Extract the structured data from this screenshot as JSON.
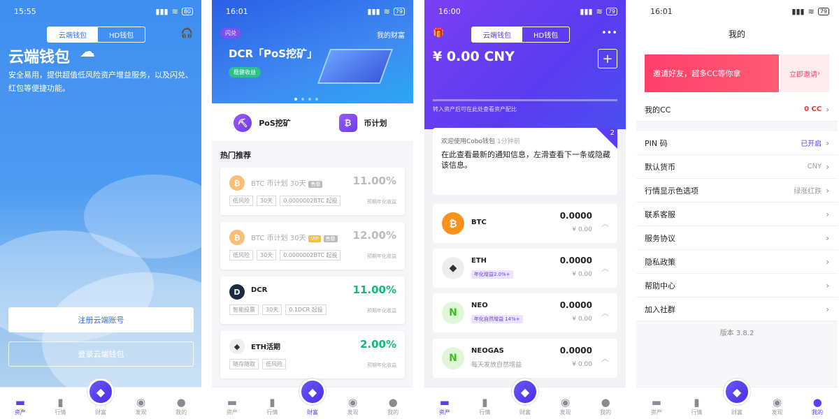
{
  "screen1": {
    "status": {
      "time": "15:55",
      "battery": "80"
    },
    "tabs": [
      "云端钱包",
      "HD钱包"
    ],
    "title": "云端钱包",
    "desc": "安全易用，提供超值低风险资产增益服务，以及闪兑、红包等便捷功能。",
    "register": "注册云端账号",
    "login": "登录云端钱包",
    "nav": [
      "资产",
      "行情",
      "财富",
      "发现",
      "我的"
    ]
  },
  "screen2": {
    "status": {
      "time": "16:01",
      "battery": "79"
    },
    "flash": "闪兑",
    "my_wealth": "我的财富",
    "banner_title": "DCR「PoS挖矿」",
    "banner_tag": "稳健收益",
    "shortcuts": [
      "PoS挖矿",
      "币计划"
    ],
    "hot_title": "热门推荐",
    "cards": [
      {
        "name": "BTC 币计划 30天",
        "badge": "售罄",
        "badge2": "",
        "rate": "11.00%",
        "tags": [
          "低风险",
          "30天",
          "0.0000002BTC 起投"
        ],
        "sub": "预期年化收益",
        "coin": "₿"
      },
      {
        "name": "BTC 币计划 30天",
        "badge": "VIP",
        "badge2": "售罄",
        "rate": "12.00%",
        "tags": [
          "低风险",
          "30天",
          "0.0000002BTC 起投"
        ],
        "sub": "预期年化收益",
        "coin": "₿"
      },
      {
        "name": "DCR",
        "badge": "",
        "badge2": "",
        "rate": "11.00%",
        "tags": [
          "智能投票",
          "30天",
          "0.1DCR 起投"
        ],
        "sub": "预期年化收益",
        "coin": "D"
      },
      {
        "name": "ETH活期",
        "badge": "",
        "badge2": "",
        "rate": "2.00%",
        "tags": [
          "随存随取",
          "低风险"
        ],
        "sub": "预期年化收益",
        "coin": "◆"
      }
    ],
    "nav": [
      "资产",
      "行情",
      "财富",
      "发现",
      "我的"
    ]
  },
  "screen3": {
    "status": {
      "time": "16:00",
      "battery": "79"
    },
    "tabs": [
      "云端钱包",
      "HD钱包"
    ],
    "balance": "¥ 0.00 CNY",
    "hint": "转入资产后可在此处查看资产配比",
    "notice_badge": "2",
    "notice_head": "欢迎使用Cobo钱包",
    "notice_time": "1分钟前",
    "notice_body": "在此查看最新的通知信息，左滑查看下一条或隐藏该信息。",
    "assets": [
      {
        "name": "BTC",
        "tag": "",
        "sub": "",
        "amount": "0.0000",
        "cny": "¥ 0.00",
        "icon": "₿"
      },
      {
        "name": "ETH",
        "tag": "年化增益2.0%+",
        "sub": "",
        "amount": "0.0000",
        "cny": "¥ 0.00",
        "icon": "◆"
      },
      {
        "name": "NEO",
        "tag": "年化自然增益 14%+",
        "sub": "",
        "amount": "0.0000",
        "cny": "¥ 0.00",
        "icon": "N"
      },
      {
        "name": "NEOGAS",
        "tag": "",
        "sub": "每天发放自然增益",
        "amount": "0.0000",
        "cny": "¥ 0.00",
        "icon": "N"
      }
    ],
    "nav": [
      "资产",
      "行情",
      "财富",
      "发现",
      "我的"
    ]
  },
  "screen4": {
    "status": {
      "time": "16:01",
      "battery": "79"
    },
    "title": "我的",
    "invite_banner": "邀请好友，超多CC等你拿",
    "invite_link": "立即邀请",
    "my_cc_label": "我的CC",
    "my_cc_value": "0 CC",
    "items": [
      {
        "label": "PIN 码",
        "value": "已开启"
      },
      {
        "label": "默认货币",
        "value": "CNY"
      },
      {
        "label": "行情显示色选项",
        "value": "绿涨红跌"
      },
      {
        "label": "联系客服",
        "value": ""
      },
      {
        "label": "服务协议",
        "value": ""
      },
      {
        "label": "隐私政策",
        "value": ""
      },
      {
        "label": "帮助中心",
        "value": ""
      },
      {
        "label": "加入社群",
        "value": ""
      }
    ],
    "version": "版本 3.8.2",
    "nav": [
      "资产",
      "行情",
      "财富",
      "发现",
      "我的"
    ]
  },
  "colors": {
    "accent": "#5b3df5",
    "green": "#14b97a",
    "red": "#e23b3b",
    "btc": "#f7931a"
  }
}
